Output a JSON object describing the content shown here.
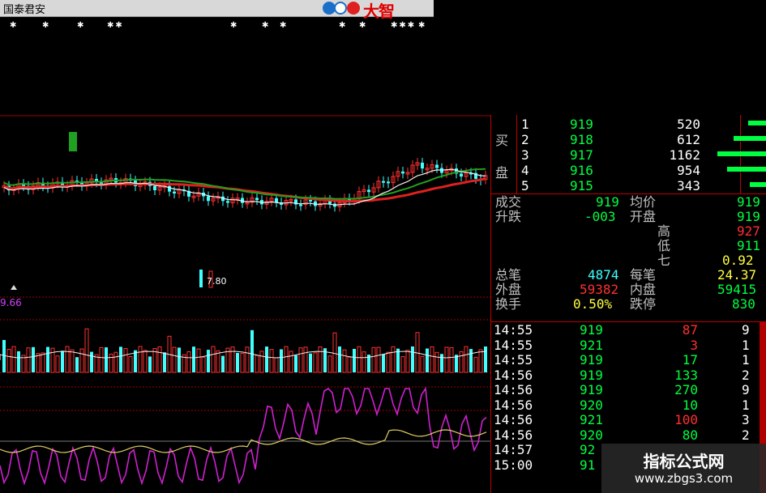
{
  "window": {
    "broker_name": "国泰君安",
    "brand": "大智"
  },
  "chart": {
    "marker_top": "7.80",
    "macd_value": "9.66"
  },
  "order_book": {
    "buy_label_1": "买",
    "buy_label_2": "盘",
    "levels": [
      {
        "idx": "1",
        "price": "919",
        "vol": "520"
      },
      {
        "idx": "2",
        "price": "918",
        "vol": "612"
      },
      {
        "idx": "3",
        "price": "917",
        "vol": "1162"
      },
      {
        "idx": "4",
        "price": "916",
        "vol": "954"
      },
      {
        "idx": "5",
        "price": "915",
        "vol": "343"
      }
    ]
  },
  "quote": {
    "row1": {
      "k1": "成交",
      "v1": "919",
      "k2": "均价",
      "v2": "919"
    },
    "row2": {
      "k1": "升跌",
      "v1": "-003",
      "k2": "开盘",
      "v2": "919"
    },
    "row3": {
      "k2": "高",
      "v2": "927"
    },
    "row4": {
      "k2": "低",
      "v2": "911"
    },
    "row5": {
      "k2": "七",
      "v2": "0.92"
    },
    "row6": {
      "k1": "总笔",
      "v1": "4874",
      "k2": "每笔",
      "v2": "24.37"
    },
    "row7": {
      "k1": "外盘",
      "v1": "59382",
      "k2": "内盘",
      "v2": "59415"
    },
    "row8": {
      "k1": "换手",
      "v1": "0.50%",
      "k2": "跌停",
      "v2": "830"
    }
  },
  "ticks": [
    {
      "time": "14:55",
      "price": "919",
      "vol": "87",
      "n": "9"
    },
    {
      "time": "14:55",
      "price": "921",
      "vol": "3",
      "n": "1"
    },
    {
      "time": "14:55",
      "price": "919",
      "vol": "17",
      "n": "1"
    },
    {
      "time": "14:56",
      "price": "919",
      "vol": "133",
      "n": "2"
    },
    {
      "time": "14:56",
      "price": "919",
      "vol": "270",
      "n": "9"
    },
    {
      "time": "14:56",
      "price": "920",
      "vol": "10",
      "n": "1"
    },
    {
      "time": "14:56",
      "price": "921",
      "vol": "100",
      "n": "3"
    },
    {
      "time": "14:56",
      "price": "920",
      "vol": "80",
      "n": "2"
    },
    {
      "time": "14:57",
      "price": "92"
    },
    {
      "time": "15:00",
      "price": "91"
    }
  ],
  "watermark": {
    "title": "指标公式网",
    "url": "www.zbgs3.com"
  },
  "colors": {
    "up": "#ff3030",
    "down": "#40ffff",
    "ma_red": "#e02020",
    "ma_green": "#20a020",
    "ma_white": "#f0f0f0",
    "kdj_purple": "#d020d0",
    "kdj_yellow": "#e0d060"
  }
}
